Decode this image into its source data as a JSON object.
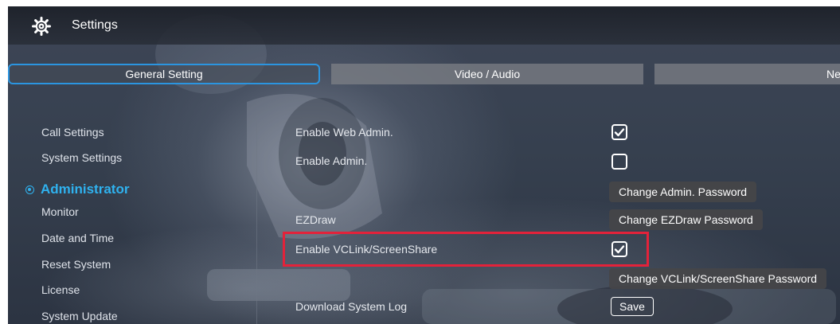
{
  "header": {
    "title": "Settings",
    "icon": "gear-icon"
  },
  "tabs": [
    {
      "label": "General Setting",
      "active": true
    },
    {
      "label": "Video / Audio",
      "active": false
    },
    {
      "label": "Network",
      "active": false
    }
  ],
  "sidebar": {
    "items": [
      {
        "label": "Call Settings"
      },
      {
        "label": "System Settings"
      },
      {
        "label": "Administrator",
        "active": true
      },
      {
        "label": "Monitor"
      },
      {
        "label": "Date and Time"
      },
      {
        "label": "Reset System"
      },
      {
        "label": "License"
      },
      {
        "label": "System Update"
      }
    ]
  },
  "settings": {
    "web_admin": {
      "label": "Enable Web Admin.",
      "checked": true
    },
    "admin": {
      "label": "Enable Admin.",
      "checked": false
    },
    "change_admin_password": "Change Admin. Password",
    "ezdraw": {
      "label": "EZDraw",
      "button": "Change EZDraw Password"
    },
    "vclink": {
      "label": "Enable VCLink/ScreenShare",
      "checked": true
    },
    "change_vclink_password": "Change VCLink/ScreenShare Password",
    "download_log": {
      "label": "Download System Log",
      "button": "Save"
    }
  },
  "colors": {
    "accent": "#2fb2ef",
    "tab_border": "#2b95e0",
    "highlight": "#e3223a"
  }
}
